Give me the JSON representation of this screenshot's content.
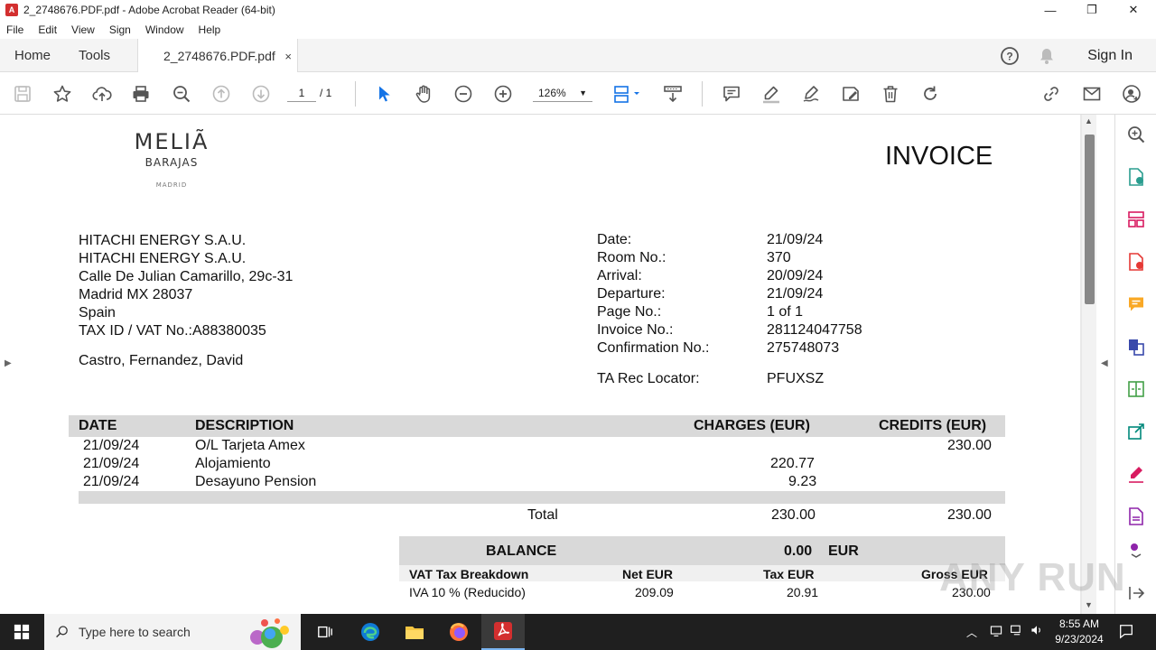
{
  "window": {
    "title": "2_2748676.PDF.pdf - Adobe Acrobat Reader (64-bit)",
    "min": "—",
    "max": "❐",
    "close": "✕"
  },
  "menu": [
    "File",
    "Edit",
    "View",
    "Sign",
    "Window",
    "Help"
  ],
  "tabs": {
    "home": "Home",
    "tools": "Tools",
    "doc": "2_2748676.PDF.pdf",
    "doc_close": "×",
    "signin": "Sign In"
  },
  "toolbar": {
    "page_current": "1",
    "page_total": "/ 1",
    "zoom": "126%"
  },
  "invoice": {
    "logo_name": "MELIÃ",
    "logo_sub": "BARAJAS",
    "logo_city": "MADRID",
    "title": "INVOICE",
    "address": [
      "HITACHI ENERGY S.A.U.",
      "HITACHI ENERGY S.A.U.",
      "Calle De Julian Camarillo, 29c-31",
      "Madrid MX 28037",
      "Spain",
      "TAX ID / VAT No.:A88380035"
    ],
    "guest": "Castro, Fernandez, David",
    "details": [
      {
        "label": "Date:",
        "value": "21/09/24"
      },
      {
        "label": "Room No.:",
        "value": "370"
      },
      {
        "label": "Arrival:",
        "value": "20/09/24"
      },
      {
        "label": "Departure:",
        "value": "21/09/24"
      },
      {
        "label": "Page No.:",
        "value": "1 of 1"
      },
      {
        "label": "Invoice No.:",
        "value": "281124047758"
      },
      {
        "label": "Confirmation No.:",
        "value": "275748073"
      },
      {
        "label": "TA Rec Locator:",
        "value": "PFUXSZ"
      }
    ],
    "table_headers": {
      "date": "DATE",
      "description": "DESCRIPTION",
      "charges": "CHARGES (EUR)",
      "credits": "CREDITS (EUR)"
    },
    "rows": [
      {
        "date": "21/09/24",
        "description": "O/L Tarjeta Amex",
        "charges": "",
        "credits": "230.00"
      },
      {
        "date": "21/09/24",
        "description": "Alojamiento",
        "charges": "220.77",
        "credits": ""
      },
      {
        "date": "21/09/24",
        "description": "Desayuno Pension",
        "charges": "9.23",
        "credits": ""
      }
    ],
    "total": {
      "label": "Total",
      "charges": "230.00",
      "credits": "230.00"
    },
    "balance": {
      "label": "BALANCE",
      "value": "0.00",
      "currency": "EUR"
    },
    "vat": {
      "headers": {
        "breakdown": "VAT Tax Breakdown",
        "net": "Net EUR",
        "tax": "Tax EUR",
        "gross": "Gross EUR"
      },
      "row": {
        "breakdown": "IVA 10 % (Reducido)",
        "net": "209.09",
        "tax": "20.91",
        "gross": "230.00"
      }
    }
  },
  "taskbar": {
    "search_placeholder": "Type here to search",
    "time": "8:55 AM",
    "date": "9/23/2024"
  },
  "watermark": "ANY RUN",
  "colors": {
    "acrobat_red": "#d32f2f",
    "select_blue": "#1473e6",
    "right_panel_accent": "#d81b60"
  }
}
